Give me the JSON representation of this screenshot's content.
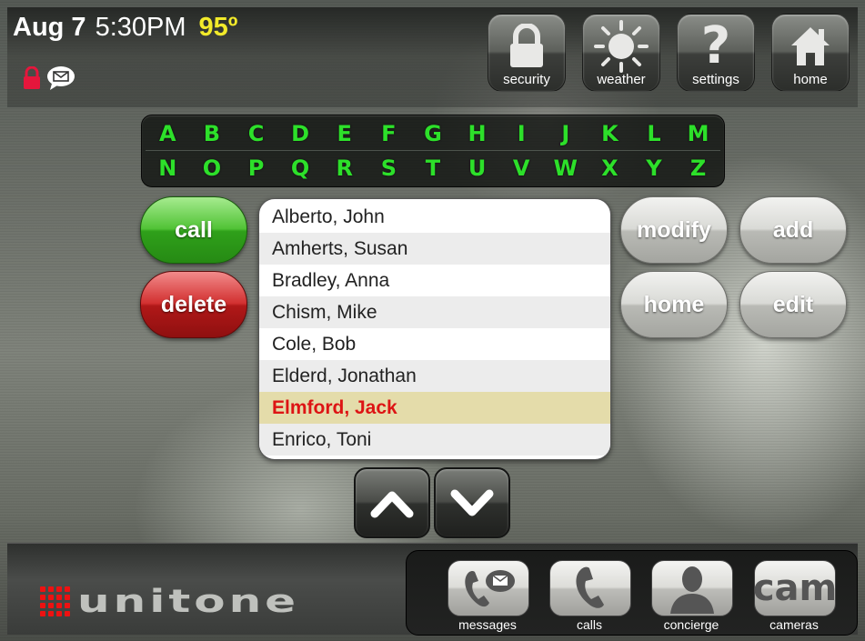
{
  "status": {
    "date": "Aug 7",
    "time": "5:30PM",
    "temperature": "95º",
    "icons": [
      "lock-icon",
      "message-icon"
    ]
  },
  "nav": [
    {
      "label": "security",
      "icon": "lock-icon"
    },
    {
      "label": "weather",
      "icon": "sun-icon"
    },
    {
      "label": "settings",
      "icon": "question-icon"
    },
    {
      "label": "home",
      "icon": "house-icon"
    }
  ],
  "alphabet": {
    "row1": [
      "A",
      "B",
      "C",
      "D",
      "E",
      "F",
      "G",
      "H",
      "I",
      "J",
      "K",
      "L",
      "M"
    ],
    "row2": [
      "N",
      "O",
      "P",
      "Q",
      "R",
      "S",
      "T",
      "U",
      "V",
      "W",
      "X",
      "Y",
      "Z"
    ],
    "color": "#2de02a"
  },
  "actions": {
    "call": "call",
    "delete": "delete",
    "modify": "modify",
    "add": "add",
    "home": "home",
    "edit": "edit"
  },
  "contacts": {
    "items": [
      "Alberto, John",
      "Amherts, Susan",
      "Bradley, Anna",
      "Chism, Mike",
      "Cole, Bob",
      "Elderd, Jonathan",
      "Elmford, Jack",
      "Enrico, Toni"
    ],
    "selected": "Elmford, Jack"
  },
  "scroll": {
    "up": "chevron-up-icon",
    "down": "chevron-down-icon"
  },
  "brand": {
    "logo_text": "unitone",
    "dot_color": "#ee1111"
  },
  "dock": [
    {
      "label": "messages",
      "icon": "phone-message-icon"
    },
    {
      "label": "calls",
      "icon": "phone-icon"
    },
    {
      "label": "concierge",
      "icon": "person-icon"
    },
    {
      "label": "cameras",
      "icon": "cam-icon",
      "icon_text": "cam"
    }
  ]
}
